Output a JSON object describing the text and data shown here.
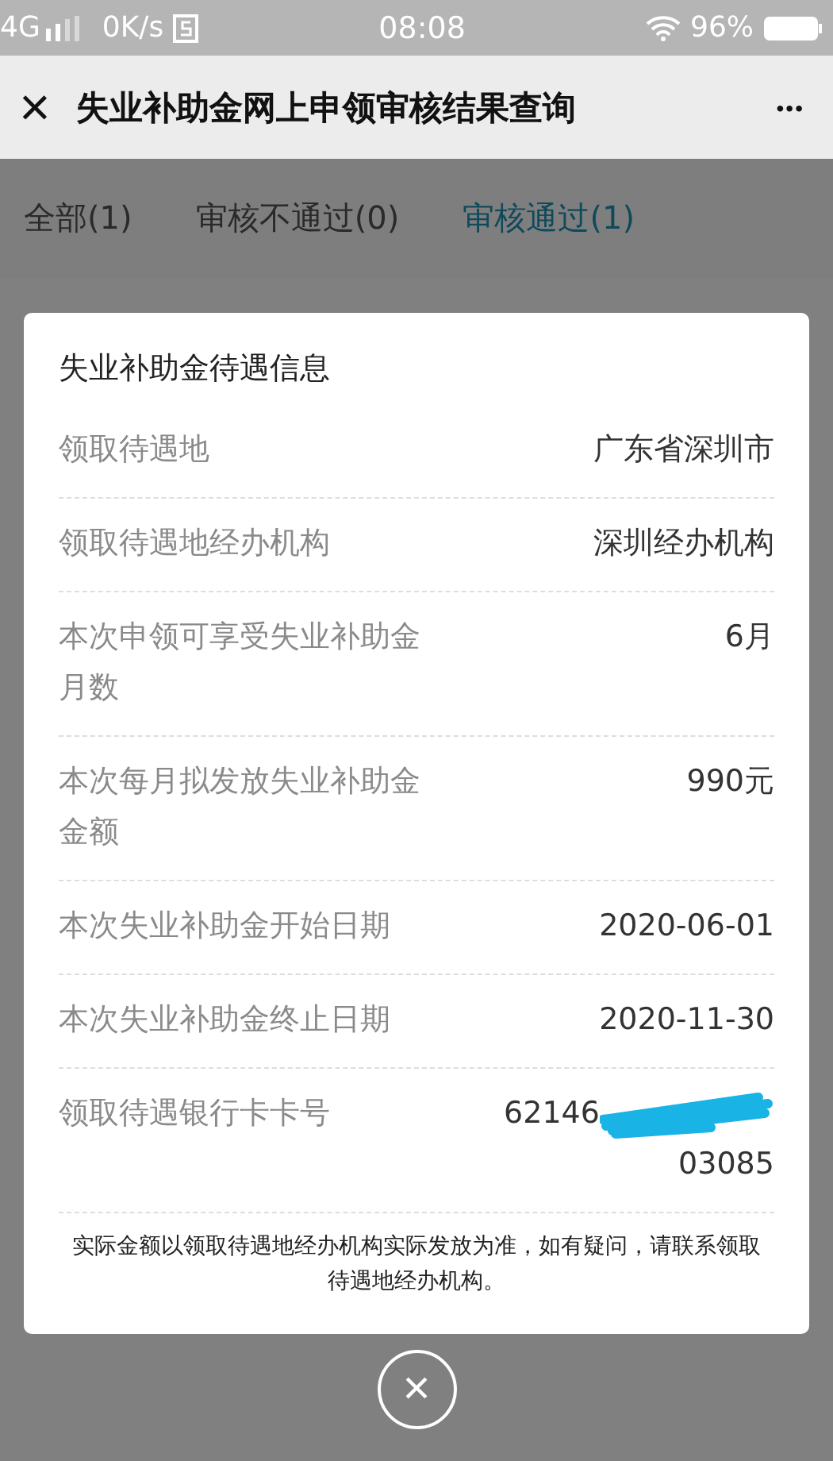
{
  "status_bar": {
    "network": "4G",
    "speed": "0K/s",
    "time": "08:08",
    "battery": "96%"
  },
  "header": {
    "close": "×",
    "title": "失业补助金网上申领审核结果查询",
    "more": "•••"
  },
  "tabs": [
    {
      "label": "全部(1)",
      "selected": false
    },
    {
      "label": "审核不通过(0)",
      "selected": false
    },
    {
      "label": "审核通过(1)",
      "selected": true
    }
  ],
  "dialog": {
    "title": "失业补助金待遇信息",
    "rows": [
      {
        "label": "领取待遇地",
        "value": "广东省深圳市"
      },
      {
        "label": "领取待遇地经办机构",
        "value": "深圳经办机构"
      },
      {
        "label": "本次申领可享受失业补助金月数",
        "value": "6月"
      },
      {
        "label": "本次每月拟发放失业补助金金额",
        "value": "990元"
      },
      {
        "label": "本次失业补助金开始日期",
        "value": "2020-06-01"
      },
      {
        "label": "本次失业补助金终止日期",
        "value": "2020-11-30"
      },
      {
        "label": "领取待遇银行卡卡号",
        "kind": "redacted",
        "value": "62146",
        "value_end": "03085"
      }
    ],
    "note": "实际金额以领取待遇地经办机构实际发放为准，如有疑问，请联系领取待遇地经办机构。"
  }
}
